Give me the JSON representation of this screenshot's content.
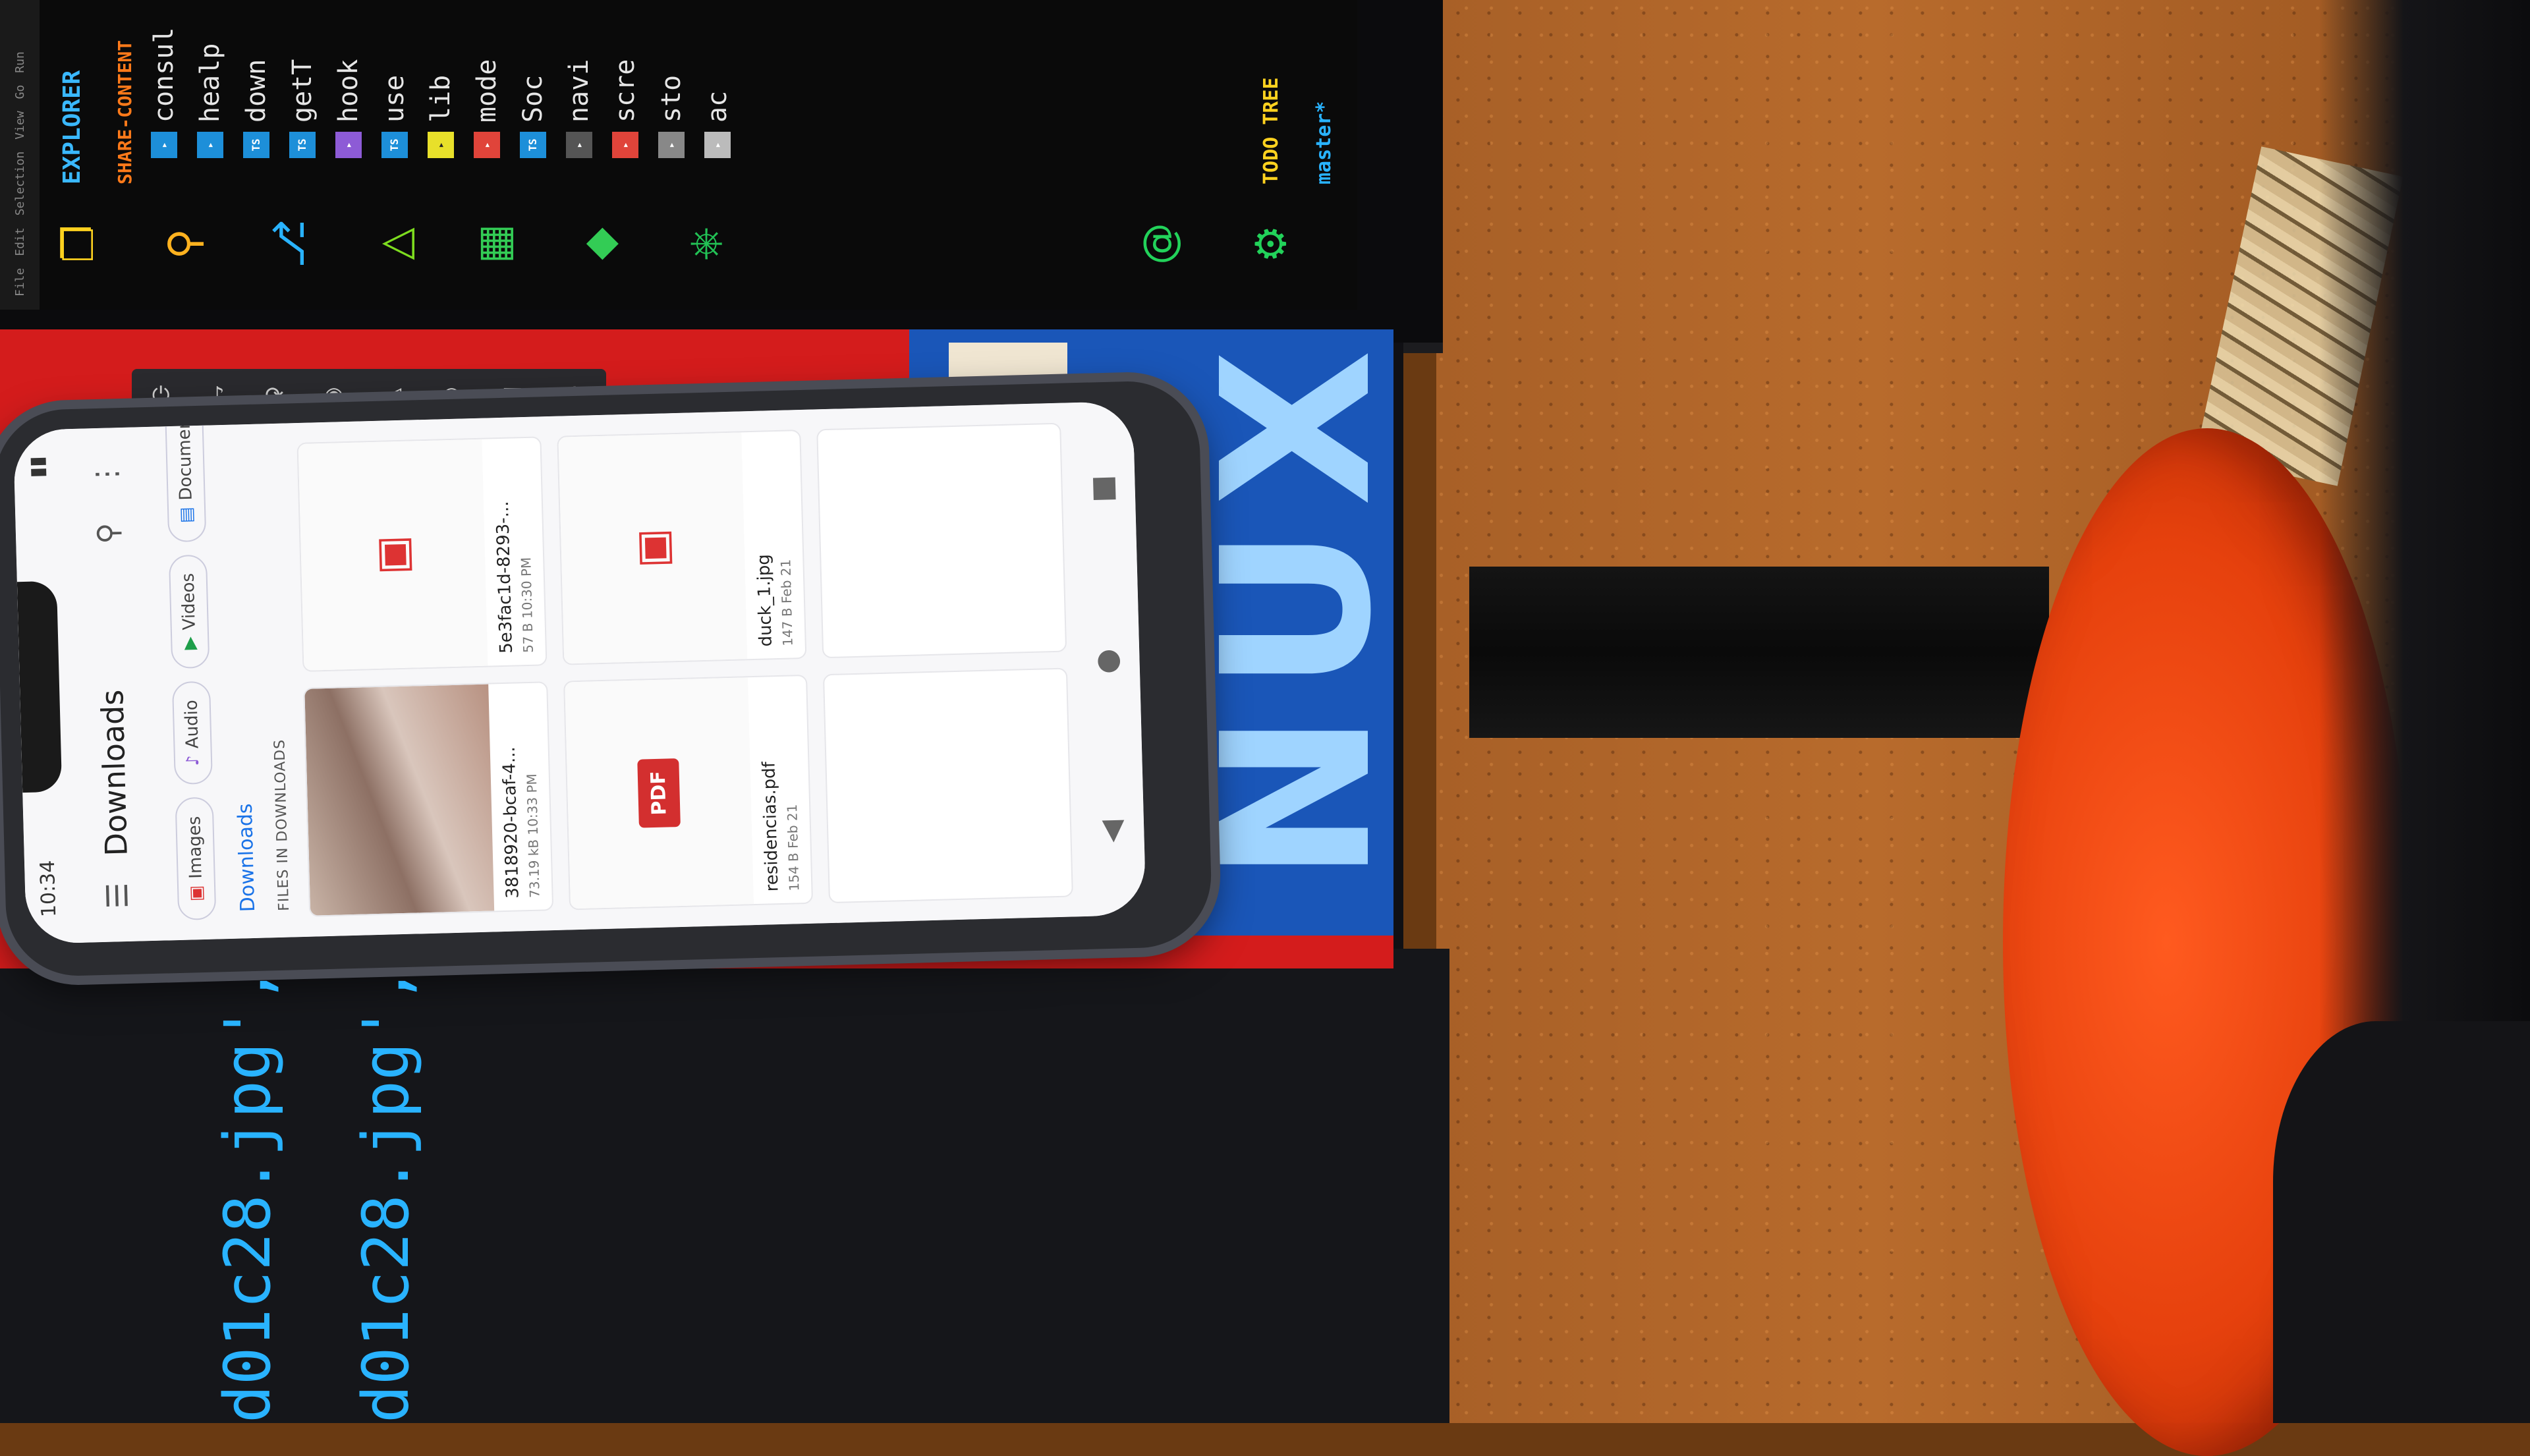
{
  "editor": {
    "menu": [
      "File",
      "Edit",
      "Selection",
      "View",
      "Go",
      "Run"
    ],
    "explorer_title": "EXPLORER",
    "section_title": "SHARE-CONTENT",
    "tree": [
      "consul",
      "healp",
      "down",
      "getT",
      "hook",
      "use",
      "lib",
      "mode",
      "Soc",
      "navi",
      "scre",
      "sto",
      "ac"
    ],
    "panel_items": [
      "TODO TREE",
      "master*"
    ],
    "activity_icons": [
      "files-icon",
      "search-icon",
      "source-control-icon",
      "run-debug-icon",
      "extensions-icon",
      "docker-icon",
      "kubernetes-icon",
      "account-icon",
      "settings-icon"
    ]
  },
  "wallpaper": {
    "brand_text": "NUX"
  },
  "phone": {
    "status_time": "10:34",
    "app_title": "Downloads",
    "chips": [
      "Images",
      "Audio",
      "Videos",
      "Documents"
    ],
    "breadcrumb": "Downloads",
    "section_header": "FILES IN DOWNLOADS",
    "files": [
      {
        "name": "3818920-bcaf-4...",
        "meta": "73.19 kB 10:33 PM",
        "kind": "photo"
      },
      {
        "name": "5e3fac1d-8293-...",
        "meta": "57 B 10:30 PM",
        "kind": "image"
      },
      {
        "name": "residencias.pdf",
        "meta": "154 B Feb 21",
        "kind": "pdf"
      },
      {
        "name": "duck_1.jpg",
        "meta": "147 B Feb 21",
        "kind": "image"
      }
    ],
    "pdf_label": "PDF"
  },
  "code_bottom": {
    "lines": [
      "d01c28.jpg',",
      "d01c28.jpg',"
    ]
  }
}
